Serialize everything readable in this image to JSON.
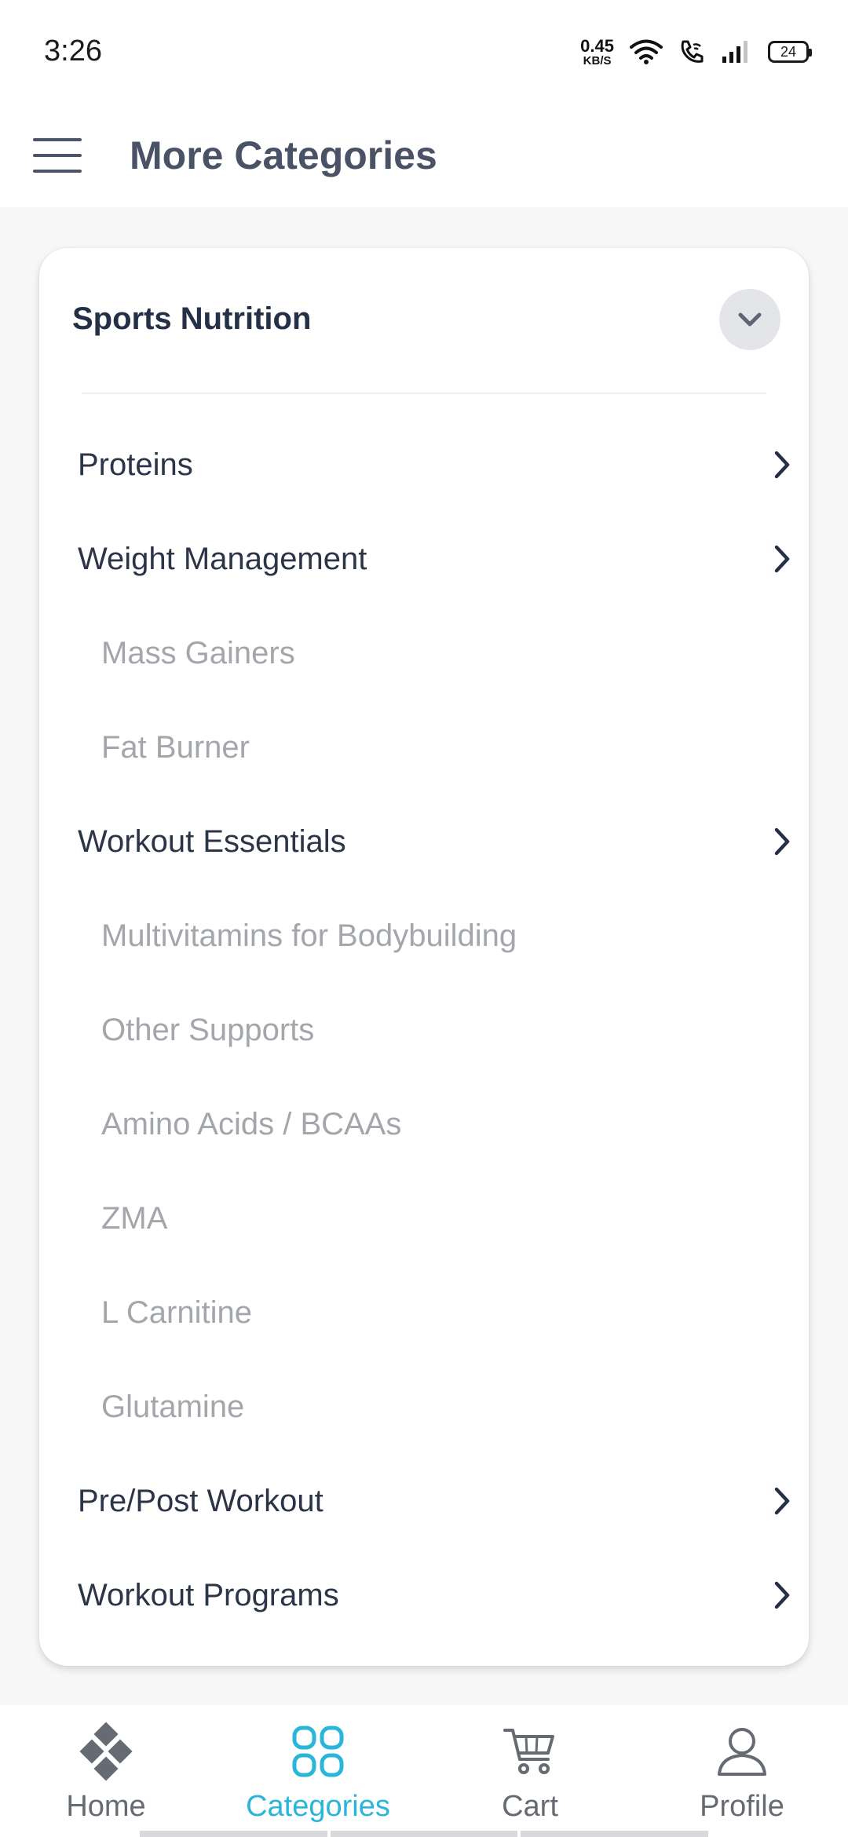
{
  "status_bar": {
    "time": "3:26",
    "net_speed_value": "0.45",
    "net_speed_unit": "KB/S",
    "battery_level": "24"
  },
  "app_bar": {
    "title": "More Categories",
    "menu_icon": "hamburger-menu-icon"
  },
  "category_card": {
    "title": "Sports Nutrition",
    "collapse_icon": "chevron-down-icon",
    "items": [
      {
        "label": "Proteins",
        "type": "parent"
      },
      {
        "label": "Weight Management",
        "type": "parent"
      },
      {
        "label": "Mass Gainers",
        "type": "child"
      },
      {
        "label": "Fat Burner",
        "type": "child"
      },
      {
        "label": "Workout Essentials",
        "type": "parent"
      },
      {
        "label": "Multivitamins for Bodybuilding",
        "type": "child"
      },
      {
        "label": "Other Supports",
        "type": "child"
      },
      {
        "label": "Amino Acids / BCAAs",
        "type": "child"
      },
      {
        "label": "ZMA",
        "type": "child"
      },
      {
        "label": "L Carnitine",
        "type": "child"
      },
      {
        "label": "Glutamine",
        "type": "child"
      },
      {
        "label": "Pre/Post Workout",
        "type": "parent"
      },
      {
        "label": "Workout Programs",
        "type": "parent"
      }
    ]
  },
  "bottom_nav": {
    "active": "Categories",
    "accent_color": "#29b6d9",
    "items": [
      {
        "label": "Home",
        "icon": "home-diamond-icon"
      },
      {
        "label": "Categories",
        "icon": "categories-grid-icon"
      },
      {
        "label": "Cart",
        "icon": "cart-icon"
      },
      {
        "label": "Profile",
        "icon": "profile-icon"
      }
    ]
  }
}
